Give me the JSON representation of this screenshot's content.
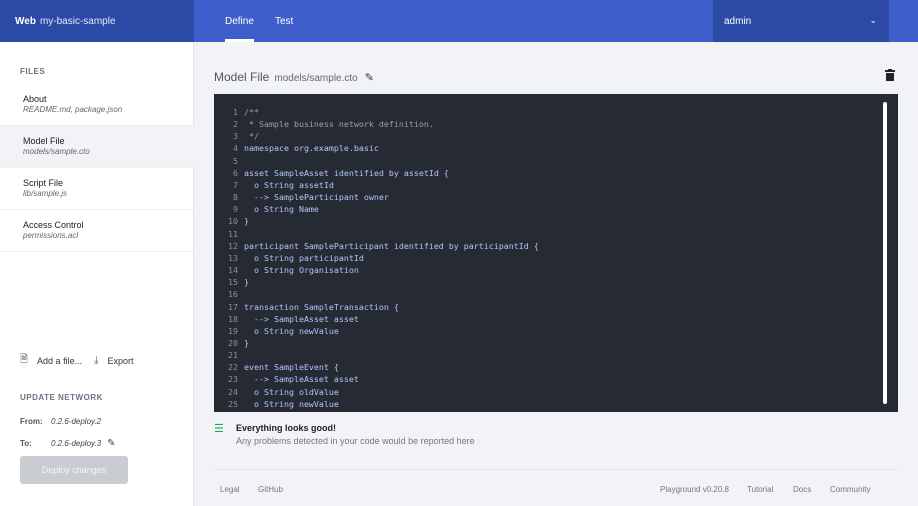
{
  "header": {
    "brand_bold": "Web",
    "brand_name": "my-basic-sample",
    "tabs": [
      {
        "label": "Define"
      },
      {
        "label": "Test"
      }
    ],
    "user": "admin"
  },
  "sidebar": {
    "files_heading": "FILES",
    "files": [
      {
        "name": "About",
        "sub": "README.md, package.json"
      },
      {
        "name": "Model File",
        "sub": "models/sample.cto"
      },
      {
        "name": "Script File",
        "sub": "lib/sample.js"
      },
      {
        "name": "Access Control",
        "sub": "permissions.acl"
      }
    ],
    "add_file": "Add a file...",
    "export": "Export",
    "update_heading": "UPDATE NETWORK",
    "from_label": "From:",
    "from_value": "0.2.6-deploy.2",
    "to_label": "To:",
    "to_value": "0.2.6-deploy.3",
    "deploy_button": "Deploy changes"
  },
  "main": {
    "title": "Model File",
    "path": "models/sample.cto",
    "code": [
      {
        "n": "1",
        "t": "/**"
      },
      {
        "n": "2",
        "t": " * Sample business network definition."
      },
      {
        "n": "3",
        "t": " */"
      },
      {
        "n": "4",
        "t": "namespace org.example.basic"
      },
      {
        "n": "5",
        "t": ""
      },
      {
        "n": "6",
        "t": "asset SampleAsset identified by assetId {"
      },
      {
        "n": "7",
        "t": "  o String assetId"
      },
      {
        "n": "8",
        "t": "  --> SampleParticipant owner"
      },
      {
        "n": "9",
        "t": "  o String Name"
      },
      {
        "n": "10",
        "t": "}"
      },
      {
        "n": "11",
        "t": ""
      },
      {
        "n": "12",
        "t": "participant SampleParticipant identified by participantId {"
      },
      {
        "n": "13",
        "t": "  o String participantId"
      },
      {
        "n": "14",
        "t": "  o String Organisation"
      },
      {
        "n": "15",
        "t": "}"
      },
      {
        "n": "16",
        "t": ""
      },
      {
        "n": "17",
        "t": "transaction SampleTransaction {"
      },
      {
        "n": "18",
        "t": "  --> SampleAsset asset"
      },
      {
        "n": "19",
        "t": "  o String newValue"
      },
      {
        "n": "20",
        "t": "}"
      },
      {
        "n": "21",
        "t": ""
      },
      {
        "n": "22",
        "t": "event SampleEvent {"
      },
      {
        "n": "23",
        "t": "  --> SampleAsset asset"
      },
      {
        "n": "24",
        "t": "  o String oldValue"
      },
      {
        "n": "25",
        "t": "  o String newValue"
      }
    ],
    "status_title": "Everything looks good!",
    "status_sub": "Any problems detected in your code would be reported here"
  },
  "footer": {
    "legal": "Legal",
    "github": "GitHub",
    "version": "Playground v0.20.8",
    "tutorial": "Tutorial",
    "docs": "Docs",
    "community": "Community"
  },
  "colors": {
    "header_bg": "#3e5ecb",
    "header_dark": "#2c49a6",
    "editor_bg": "#262b33",
    "code_text": "#b4c4ff",
    "success": "#27a35a"
  }
}
